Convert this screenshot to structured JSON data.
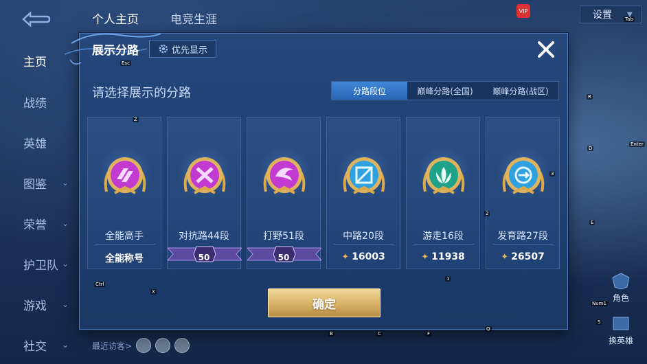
{
  "background": {
    "top_tabs": [
      "个人主页",
      "电竞生涯"
    ],
    "settings_label": "设置",
    "nav_items": [
      {
        "label": "主页",
        "active": true,
        "has_chevron": false
      },
      {
        "label": "战绩",
        "active": false,
        "has_chevron": false
      },
      {
        "label": "英雄",
        "active": false,
        "has_chevron": false
      },
      {
        "label": "图鉴",
        "active": false,
        "has_chevron": true
      },
      {
        "label": "荣誉",
        "active": false,
        "has_chevron": true
      },
      {
        "label": "护卫队",
        "active": false,
        "has_chevron": true
      },
      {
        "label": "游戏",
        "active": false,
        "has_chevron": true
      },
      {
        "label": "社交",
        "active": false,
        "has_chevron": true
      }
    ],
    "recent_visitors_label": "最近访客>",
    "right_buttons": [
      "角色",
      "换英雄"
    ]
  },
  "dialog": {
    "title": "展示分路",
    "priority_label": "优先显示",
    "subtitle": "请选择展示的分路",
    "tabs": [
      {
        "label": "分路段位",
        "active": true
      },
      {
        "label": "巅峰分路(全国)",
        "active": false
      },
      {
        "label": "巅峰分路(战区)",
        "active": false
      }
    ],
    "cards": [
      {
        "rank_label": "全能高手",
        "bottom": "全能称号",
        "kind": "title",
        "color": "#c23ad0",
        "icon": "all-round-emblem-icon"
      },
      {
        "rank_label": "对抗路44段",
        "bottom": "50",
        "kind": "banner",
        "color": "#c23ad0",
        "icon": "clash-lane-emblem-icon"
      },
      {
        "rank_label": "打野51段",
        "bottom": "50",
        "kind": "banner",
        "color": "#c23ad0",
        "icon": "jungle-emblem-icon"
      },
      {
        "rank_label": "中路20段",
        "bottom": "16003",
        "kind": "score",
        "color": "#2fa0e0",
        "icon": "mid-lane-emblem-icon"
      },
      {
        "rank_label": "游走16段",
        "bottom": "11938",
        "kind": "score",
        "color": "#1fa28a",
        "icon": "roam-emblem-icon"
      },
      {
        "rank_label": "发育路27段",
        "bottom": "26507",
        "kind": "score",
        "color": "#2fa0e0",
        "icon": "farm-lane-emblem-icon"
      }
    ],
    "confirm_label": "确定"
  },
  "key_hints": [
    "Esc",
    "Tab",
    "Ctrl",
    "Z",
    "X",
    "B",
    "C",
    "F",
    "Q",
    "R",
    "D",
    "E",
    "2",
    "3",
    "1",
    "S",
    "Enter",
    "Num1"
  ]
}
